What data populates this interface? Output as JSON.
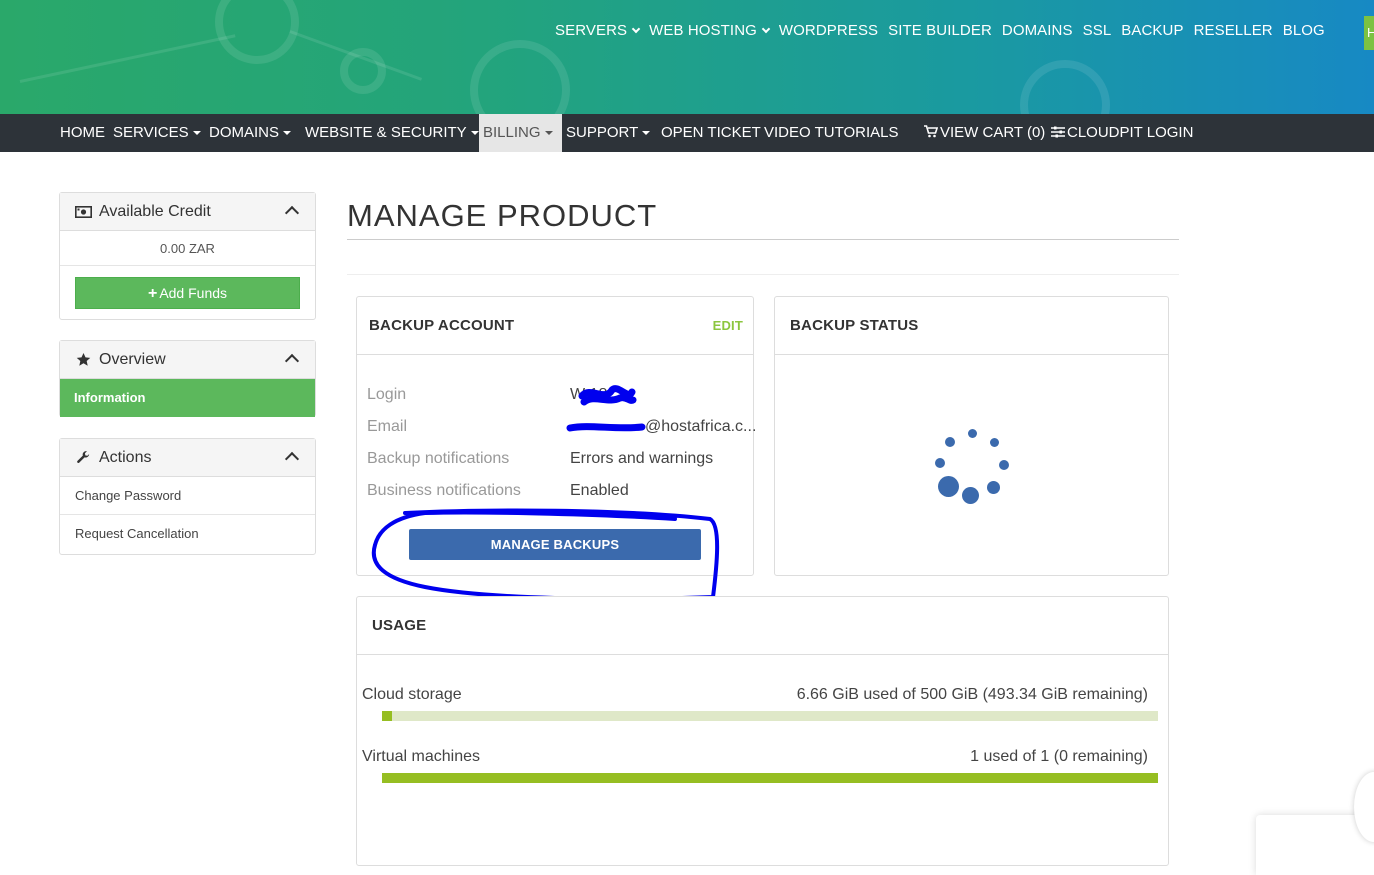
{
  "top_nav": [
    {
      "label": "SERVERS",
      "dropdown": true
    },
    {
      "label": "WEB HOSTING",
      "dropdown": true
    },
    {
      "label": "WORDPRESS",
      "dropdown": false
    },
    {
      "label": "SITE BUILDER",
      "dropdown": false
    },
    {
      "label": "DOMAINS",
      "dropdown": false
    },
    {
      "label": "SSL",
      "dropdown": false
    },
    {
      "label": "BACKUP",
      "dropdown": false
    },
    {
      "label": "RESELLER",
      "dropdown": false
    },
    {
      "label": "BLOG",
      "dropdown": false
    }
  ],
  "green_tab_label": "H",
  "subnav": {
    "home": "HOME",
    "services": "SERVICES",
    "domains": "DOMAINS",
    "website_security": "WEBSITE & SECURITY",
    "billing": "BILLING",
    "support": "SUPPORT",
    "open_ticket": "OPEN TICKET",
    "video_tutorials": "VIDEO TUTORIALS",
    "view_cart": "VIEW CART (0)",
    "cloudpit_login": "CLOUDPIT LOGIN"
  },
  "sidebar": {
    "credit": {
      "title": "Available Credit",
      "amount": "0.00 ZAR",
      "add_funds": "Add Funds"
    },
    "overview": {
      "title": "Overview",
      "items": [
        "Information"
      ]
    },
    "actions": {
      "title": "Actions",
      "items": [
        "Change Password",
        "Request Cancellation"
      ]
    }
  },
  "page": {
    "title": "MANAGE PRODUCT"
  },
  "backup_account": {
    "title": "BACKUP ACCOUNT",
    "edit": "EDIT",
    "fields": [
      {
        "label": "Login",
        "value": "W      18"
      },
      {
        "label": "Email",
        "value": "@hostafrica.c..."
      },
      {
        "label": "Backup notifications",
        "value": "Errors and warnings"
      },
      {
        "label": "Business notifications",
        "value": "Enabled"
      }
    ],
    "manage_button": "MANAGE BACKUPS"
  },
  "backup_status": {
    "title": "BACKUP STATUS"
  },
  "usage": {
    "title": "USAGE",
    "rows": [
      {
        "label": "Cloud storage",
        "value": "6.66 GiB used of 500 GiB (493.34 GiB remaining)",
        "fraction": 0.0133
      },
      {
        "label": "Virtual machines",
        "value": "1 used of 1 (0 remaining)",
        "fraction": 1.0
      }
    ]
  },
  "colors": {
    "accent_green": "#5cb85c",
    "primary_blue": "#3b6aad",
    "bar_green": "#96be22",
    "edit_green": "#8cc63f",
    "annotation": "#0000ee"
  }
}
